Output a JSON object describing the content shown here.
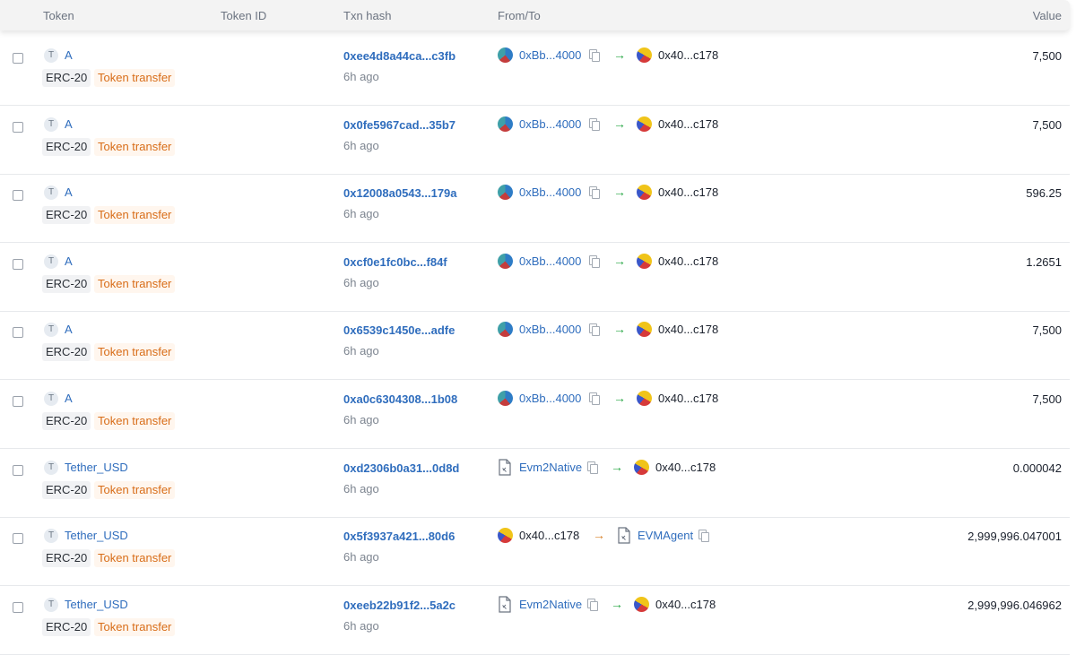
{
  "columns": {
    "token": "Token",
    "token_id": "Token ID",
    "txn_hash": "Txn hash",
    "from_to": "From/To",
    "value": "Value"
  },
  "rows": [
    {
      "token_letter": "T",
      "token": "A",
      "standard": "ERC-20",
      "type": "Token transfer",
      "hash": "0xee4d8a44ca...c3fb",
      "age": "6h ago",
      "from": "0xBb...4000",
      "from_kind": "address",
      "direction": "in",
      "to": "0x40...c178",
      "to_kind": "address",
      "value": "7,500"
    },
    {
      "token_letter": "T",
      "token": "A",
      "standard": "ERC-20",
      "type": "Token transfer",
      "hash": "0x0fe5967cad...35b7",
      "age": "6h ago",
      "from": "0xBb...4000",
      "from_kind": "address",
      "direction": "in",
      "to": "0x40...c178",
      "to_kind": "address",
      "value": "7,500"
    },
    {
      "token_letter": "T",
      "token": "A",
      "standard": "ERC-20",
      "type": "Token transfer",
      "hash": "0x12008a0543...179a",
      "age": "6h ago",
      "from": "0xBb...4000",
      "from_kind": "address",
      "direction": "in",
      "to": "0x40...c178",
      "to_kind": "address",
      "value": "596.25"
    },
    {
      "token_letter": "T",
      "token": "A",
      "standard": "ERC-20",
      "type": "Token transfer",
      "hash": "0xcf0e1fc0bc...f84f",
      "age": "6h ago",
      "from": "0xBb...4000",
      "from_kind": "address",
      "direction": "in",
      "to": "0x40...c178",
      "to_kind": "address",
      "value": "1.2651"
    },
    {
      "token_letter": "T",
      "token": "A",
      "standard": "ERC-20",
      "type": "Token transfer",
      "hash": "0x6539c1450e...adfe",
      "age": "6h ago",
      "from": "0xBb...4000",
      "from_kind": "address",
      "direction": "in",
      "to": "0x40...c178",
      "to_kind": "address",
      "value": "7,500"
    },
    {
      "token_letter": "T",
      "token": "A",
      "standard": "ERC-20",
      "type": "Token transfer",
      "hash": "0xa0c6304308...1b08",
      "age": "6h ago",
      "from": "0xBb...4000",
      "from_kind": "address",
      "direction": "in",
      "to": "0x40...c178",
      "to_kind": "address",
      "value": "7,500"
    },
    {
      "token_letter": "T",
      "token": "Tether_USD",
      "standard": "ERC-20",
      "type": "Token transfer",
      "hash": "0xd2306b0a31...0d8d",
      "age": "6h ago",
      "from": "Evm2Native",
      "from_kind": "contract",
      "direction": "in",
      "to": "0x40...c178",
      "to_kind": "address",
      "value": "0.000042"
    },
    {
      "token_letter": "T",
      "token": "Tether_USD",
      "standard": "ERC-20",
      "type": "Token transfer",
      "hash": "0x5f3937a421...80d6",
      "age": "6h ago",
      "from": "0x40...c178",
      "from_kind": "self",
      "direction": "out",
      "to": "EVMAgent",
      "to_kind": "contract",
      "value": "2,999,996.047001"
    },
    {
      "token_letter": "T",
      "token": "Tether_USD",
      "standard": "ERC-20",
      "type": "Token transfer",
      "hash": "0xeeb22b91f2...5a2c",
      "age": "6h ago",
      "from": "Evm2Native",
      "from_kind": "contract",
      "direction": "in",
      "to": "0x40...c178",
      "to_kind": "address",
      "value": "2,999,996.046962"
    }
  ],
  "icons": {
    "arrow_in": "→",
    "arrow_out": "→",
    "arrow_in_color": "#27a745",
    "arrow_out_color": "#d9822b",
    "link_color": "#2f6dbd",
    "badge_type_color": "#d86d18"
  }
}
